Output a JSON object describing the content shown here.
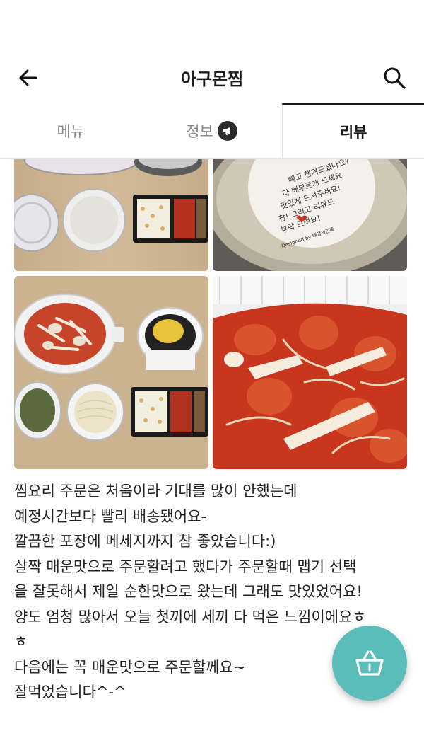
{
  "header": {
    "title": "아구몬찜",
    "back_icon": "arrow-left-icon",
    "search_icon": "search-icon"
  },
  "tabs": [
    {
      "label": "메뉴",
      "active": false
    },
    {
      "label": "정보",
      "active": false,
      "icon": "megaphone-icon"
    },
    {
      "label": "리뷰",
      "active": true
    }
  ],
  "photos": [
    {
      "name": "review-photo-1",
      "sticker_text": [
        "빼고 챙겨드셨나요?",
        "그럼 다 배부르게 드세요오~",
        "맛있게 드셔주세요!",
        "참! 그리고 리뷰도",
        "부탁 드려요!"
      ],
      "sticker_brand": "Designed by 배달의민족"
    },
    {
      "name": "review-photo-2"
    },
    {
      "name": "review-photo-3"
    },
    {
      "name": "review-photo-4"
    }
  ],
  "review": {
    "lines": [
      "찜요리 주문은 처음이라 기대를 많이 안했는데",
      "예정시간보다 빨리 배송됐어요-",
      "깔끔한 포장에 메세지까지 참 좋았습니다:)",
      "살짝 매운맛으로 주문할려고 했다가 주문할때 맵기 선택",
      "을 잘못해서 제일 순한맛으로 왔는데 그래도 맛있었어요!",
      "양도 엄청 많아서 오늘 첫끼에 세끼 다 먹은 느낌이에요ㅎ",
      "ㅎ",
      "다음에는 꼭 매운맛으로 주문할께요~",
      "잘먹었습니다^-^"
    ]
  },
  "fab": {
    "icon": "basket-icon",
    "color": "#5bbdba"
  }
}
